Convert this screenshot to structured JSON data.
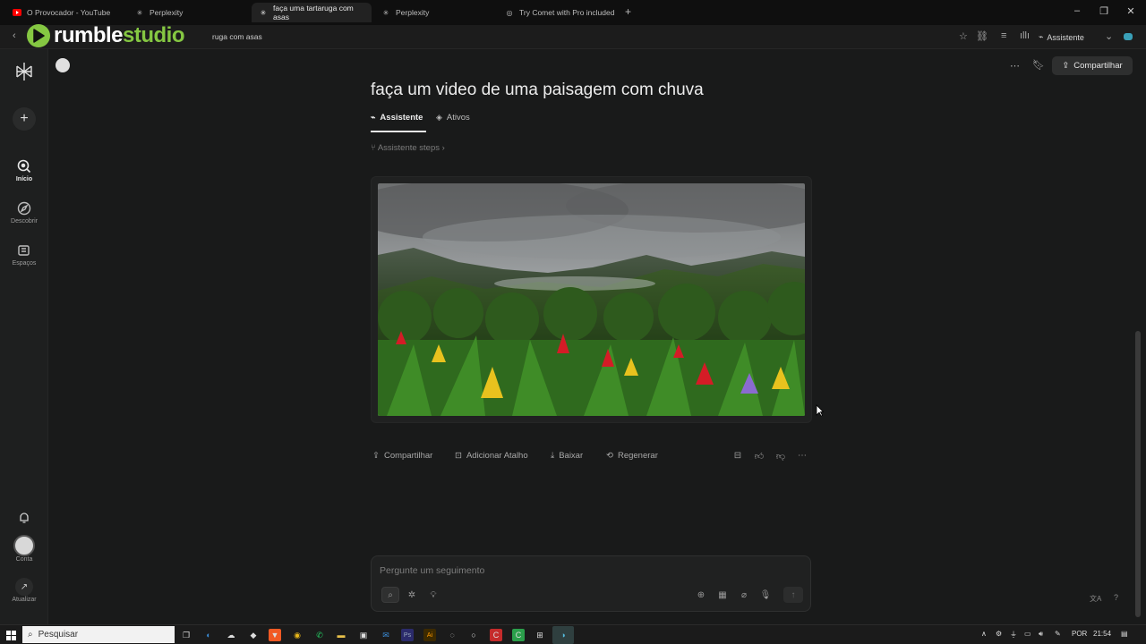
{
  "tabs": [
    {
      "label": "O Provocador - YouTube",
      "icon": "youtube-icon",
      "color": "#ff0000"
    },
    {
      "label": "Perplexity",
      "icon": "perplexity-icon"
    },
    {
      "label": "faça uma tartaruga com asas",
      "icon": "perplexity-icon",
      "active": true
    },
    {
      "label": "Perplexity",
      "icon": "perplexity-icon"
    },
    {
      "label": "Try Comet with Pro included",
      "icon": "comet-icon"
    }
  ],
  "address_bar": {
    "url_text": "ruga com asas",
    "assistant_label": "Assistente"
  },
  "watermark": {
    "part1": "rumble",
    "part2": "studio",
    "color": "#85c742"
  },
  "sidebar": {
    "items": [
      {
        "label": "Início",
        "icon": "home-search-icon"
      },
      {
        "label": "Descobrir",
        "icon": "compass-icon"
      },
      {
        "label": "Espaços",
        "icon": "spaces-icon"
      }
    ],
    "account_label": "Conta",
    "upgrade_label": "Atualizar"
  },
  "page": {
    "title": "faça um video de uma paisagem com chuva",
    "tab_assistant": "Assistente",
    "tab_assets": "Ativos",
    "steps_label": "Assistente steps",
    "share_top": "Compartilhar"
  },
  "actions": {
    "share": "Compartilhar",
    "add_shortcut": "Adicionar Atalho",
    "download": "Baixar",
    "regenerate": "Regenerar"
  },
  "composer": {
    "placeholder": "Pergunte um seguimento"
  },
  "taskbar": {
    "search_label": "Pesquisar",
    "language": "POR",
    "time": "21:54"
  },
  "colors": {
    "background": "#191a1a",
    "accent_green": "#85c742"
  }
}
